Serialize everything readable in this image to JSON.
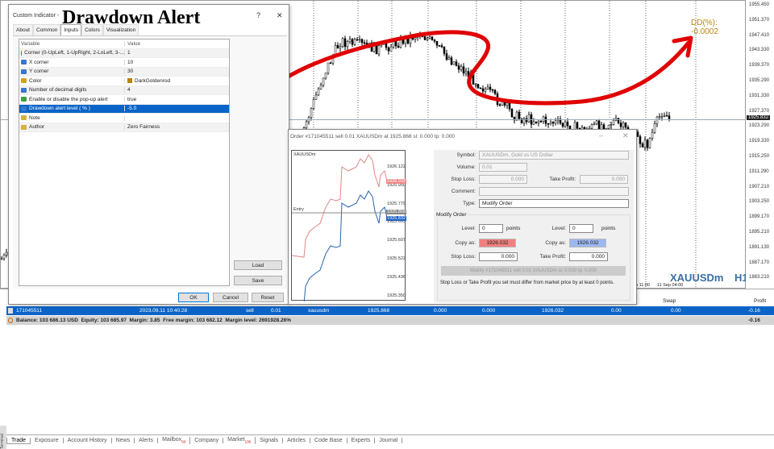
{
  "chart": {
    "symbol": "XAUUSDm",
    "timeframe": "H1",
    "dd_label": "DD(%): -0.0002",
    "current_price": "1925.832",
    "price_ticks": [
      "1955.450",
      "1951.370",
      "1947.410",
      "1943.330",
      "1939.370",
      "1935.290",
      "1931.330",
      "1927.370",
      "1923.290",
      "1919.330",
      "1915.250",
      "1911.290",
      "1907.210",
      "1903.250",
      "1899.170",
      "1895.210",
      "1891.130",
      "1887.170",
      "1883.210"
    ],
    "time_labels": [
      "p 11:00",
      "11 Sep 04:00"
    ],
    "colors": {
      "annotation": "#e00000",
      "dd": "#b8860b",
      "bull": "#000000"
    }
  },
  "indicator_dialog": {
    "title": "Custom Indicator -",
    "overlay_title": "Drawdown Alert",
    "help": "?",
    "close": "✕",
    "tabs": [
      "About",
      "Common",
      "Inputs",
      "Colors",
      "Visualization"
    ],
    "active_tab": "Inputs",
    "columns": [
      "Variable",
      "Value"
    ],
    "rows": [
      {
        "icon": "num",
        "variable": "Corner (0-UpLeft, 1-UpRight, 2-LoLeft, 3-...",
        "value": "1"
      },
      {
        "icon": "num",
        "variable": "X corner",
        "value": "10"
      },
      {
        "icon": "num",
        "variable": "Y corner",
        "value": "30"
      },
      {
        "icon": "color",
        "variable": "Color",
        "value": "DarkGoldenrod"
      },
      {
        "icon": "num",
        "variable": "Number of decimal digits",
        "value": "4"
      },
      {
        "icon": "bool",
        "variable": "Enable or disable the pop-up alert",
        "value": "true"
      },
      {
        "icon": "double",
        "variable": "Drawdown alert level ( % )",
        "value": "-5.0",
        "selected": true
      },
      {
        "icon": "str",
        "variable": "Note",
        "value": ""
      },
      {
        "icon": "str",
        "variable": "Author",
        "value": "Zero Fairness"
      }
    ],
    "color_swatch": "#b8860b",
    "load": "Load",
    "save": "Save",
    "ok": "OK",
    "cancel": "Cancel",
    "reset": "Reset"
  },
  "order_dialog": {
    "title": "Order #171045511 sell 0.01 XAUUSDm at 1925.868 sl: 0.000 tp: 0.000",
    "mini_symbol": "XAUUSDm",
    "entry": "Entry",
    "mini_ticks": [
      "1926.122",
      "1925.950",
      "1925.779",
      "1925.693",
      "1925.607",
      "1925.522",
      "1925.436",
      "1925.350"
    ],
    "ask_tag": "1926.032",
    "entry_tag": "1925.868",
    "bid_tag": "1925.832",
    "symbol_label": "Symbol:",
    "symbol": "XAUUSDm, Gold vs US Dollar",
    "volume_label": "Volume:",
    "volume": "0.01",
    "sl_label": "Stop Loss:",
    "sl": "0.000",
    "tp_label": "Take Profit:",
    "tp": "0.000",
    "comment_label": "Comment:",
    "type_label": "Type:",
    "type": "Modify Order",
    "group": "Modify Order",
    "level_label": "Level:",
    "level_left": "0",
    "level_right": "0",
    "points": "points",
    "copy_label": "Copy as:",
    "copy_left": "1926.032",
    "copy_right": "1926.032",
    "sl2": "0.000",
    "tp2": "0.000",
    "modify_btn": "Modify #171045511 sell 0.01 XAUUSDm sl: 0.000 tp: 0.000",
    "note": "Stop Loss or Take Profit you set must differ from market price by at least 0 points."
  },
  "terminal": {
    "headers": {
      "swap": "Swap",
      "profit": "Profit"
    },
    "order": {
      "ticket": "171045511",
      "time": "2023.09.11 10:40:28",
      "type": "sell",
      "volume": "0.01",
      "symbol": "xauusdm",
      "price": "1925.868",
      "sl": "0.000",
      "tp": "0.000",
      "current": "1926.032",
      "commission": "0.00",
      "swap": "0.00",
      "profit": "-0.16"
    },
    "balance_line": "Balance: 103 686.13 USD  Equity: 103 685.97  Margin: 3.85  Free margin: 103 682.12  Margin level: 2691928.26%",
    "balance_profit": "-0.16",
    "side_label": "Terminal",
    "tabs": [
      {
        "label": "Trade"
      },
      {
        "label": "Exposure"
      },
      {
        "label": "Account History"
      },
      {
        "label": "News"
      },
      {
        "label": "Alerts"
      },
      {
        "label": "Mailbox",
        "badge": "93"
      },
      {
        "label": "Company"
      },
      {
        "label": "Market",
        "badge": "136"
      },
      {
        "label": "Signals"
      },
      {
        "label": "Articles"
      },
      {
        "label": "Code Base"
      },
      {
        "label": "Experts"
      },
      {
        "label": "Journal"
      }
    ]
  }
}
